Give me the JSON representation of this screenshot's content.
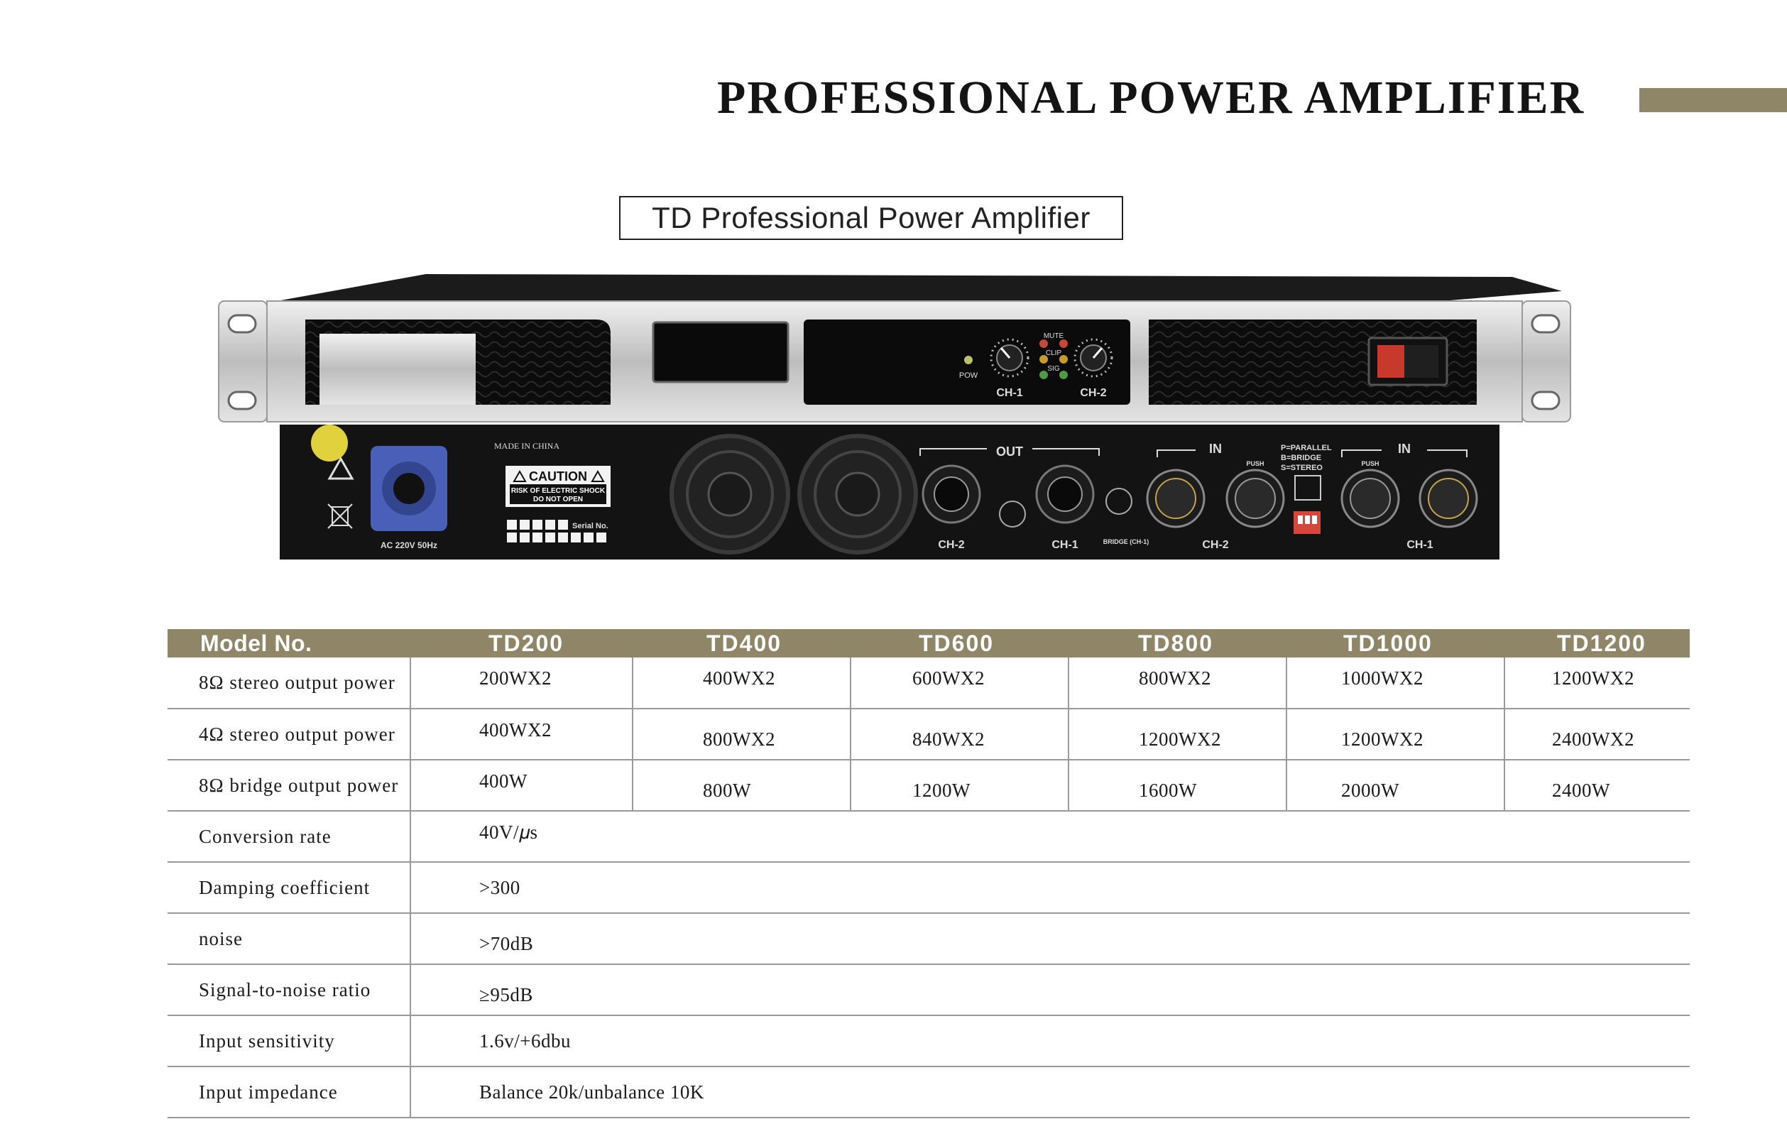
{
  "header": {
    "title": "PROFESSIONAL POWER AMPLIFIER",
    "subtitle": "TD Professional Power Amplifier"
  },
  "product": {
    "front_panel": {
      "pow_label": "POW",
      "mute_label": "MUTE",
      "clip_label": "CLIP",
      "sig_label": "SIG",
      "ch1_label": "CH-1",
      "ch2_label": "CH-2"
    },
    "rear_panel": {
      "made_in": "MADE IN CHINA",
      "caution_title": "CAUTION",
      "caution_line1": "RISK OF ELECTRIC SHOCK",
      "caution_line2": "DO NOT OPEN",
      "serial_label": "Serial No.",
      "power_rating": "AC  220V 50Hz",
      "out_label": "OUT",
      "in_label_1": "IN",
      "in_label_2": "IN",
      "mode_parallel": "P=PARALLEL",
      "mode_bridge": "B=BRIDGE",
      "mode_stereo": "S=STEREO",
      "bridge_label": "BRIDGE (CH-1)",
      "push_label": "PUSH",
      "out_ch2": "CH-2",
      "out_ch1": "CH-1",
      "in_ch2": "CH-2",
      "in_ch1": "CH-1"
    },
    "colors": {
      "chassis": "#131313",
      "brushed_metal": "#c9c9c9",
      "speakon_blue": "#4a5fb8",
      "switch_red": "#c8392b",
      "dip_red": "#d9453a"
    }
  },
  "table": {
    "headers": [
      "Model No.",
      "TD200",
      "TD400",
      "TD600",
      "TD800",
      "TD1000",
      "TD1200"
    ],
    "rows": {
      "r8st": {
        "label": "8Ω stereo output power",
        "values": [
          "200WX2",
          "400WX2",
          "600WX2",
          "800WX2",
          "1000WX2",
          "1200WX2"
        ]
      },
      "r4st": {
        "label": "4Ω stereo output power",
        "values": [
          "400WX2",
          "800WX2",
          "840WX2",
          "1200WX2",
          "1200WX2",
          "2400WX2"
        ]
      },
      "r8br": {
        "label": "8Ω bridge output power",
        "values": [
          "400W",
          "800W",
          "1200W",
          "1600W",
          "2000W",
          "2400W"
        ]
      },
      "conv": {
        "label": "Conversion rate",
        "value": "40V/𝜇s"
      },
      "damp": {
        "label": "Damping coefficient",
        "value": ">300"
      },
      "noise": {
        "label": "noise",
        "value": ">70dB"
      },
      "snr": {
        "label": "Signal-to-noise ratio",
        "value": "≥95dB"
      },
      "sens": {
        "label": "Input sensitivity",
        "value": "1.6v/+6dbu"
      },
      "imp": {
        "label": "Input impedance",
        "value": "Balance 20k/unbalance 10K"
      }
    },
    "colors": {
      "header_bg": "#8f8667",
      "header_text": "#ffffff",
      "rule": "#9a9a9a"
    }
  }
}
